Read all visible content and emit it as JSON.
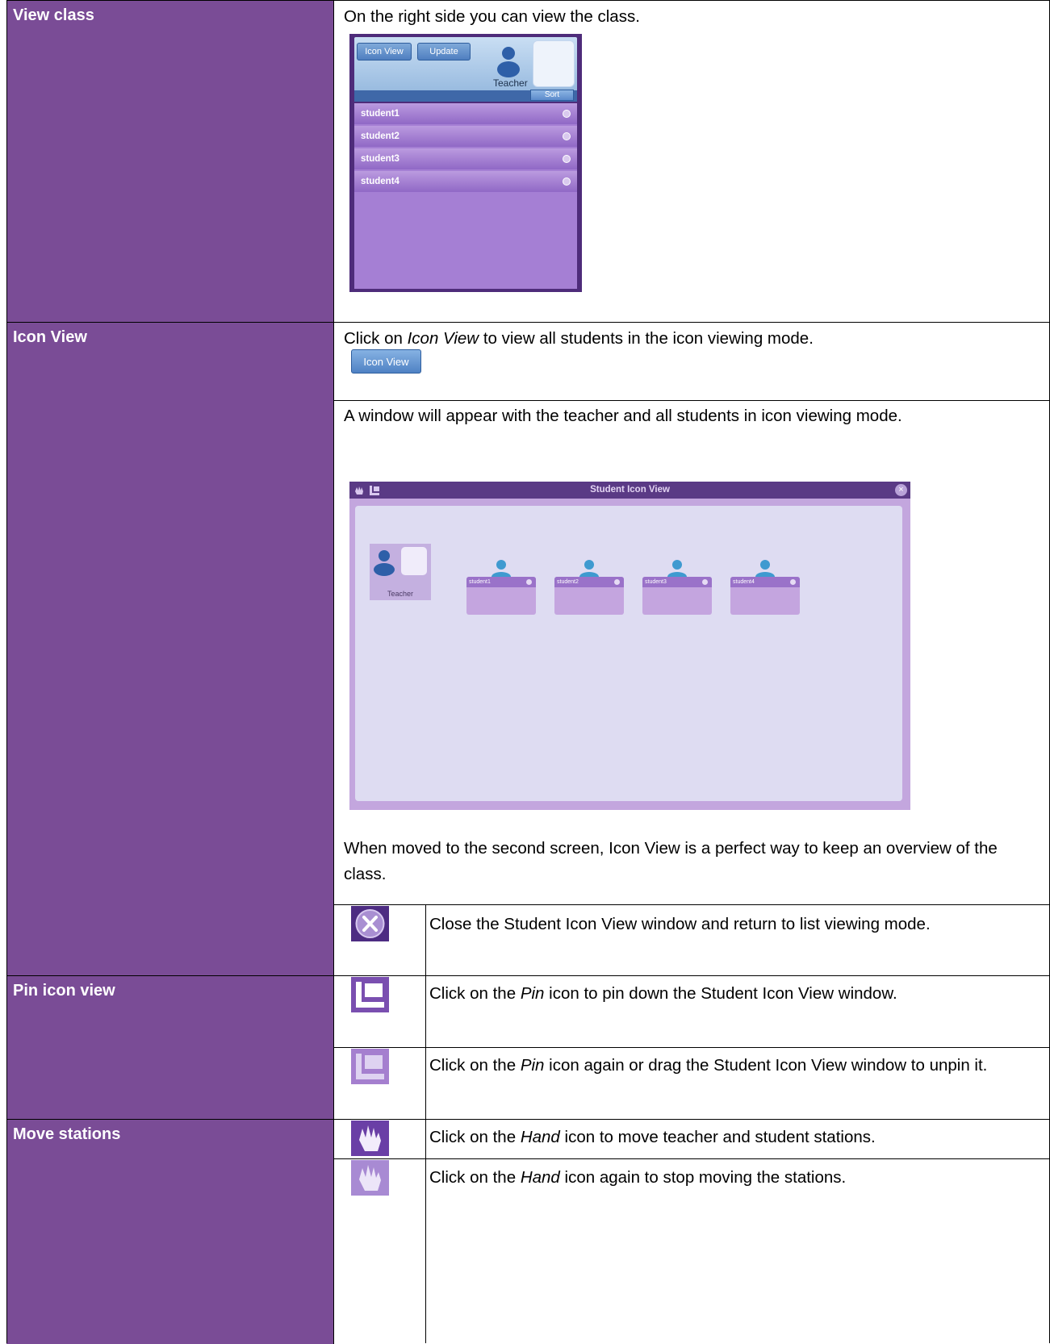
{
  "rows": {
    "view_class": {
      "label": "View class",
      "text": "On the right side you can view the class."
    },
    "icon_view": {
      "label": "Icon View",
      "text_prefix": "Click on ",
      "text_em": "Icon View",
      "text_suffix": " to view all students in the icon viewing mode.",
      "window_text": "A window will appear with the teacher and all students in icon viewing mode.",
      "overview_text": "When moved to the second screen, Icon View is a perfect way to keep an overview of the class.",
      "close_text": "Close the Student Icon View window and return to list viewing mode."
    },
    "pin_icon_view": {
      "label": "Pin icon view",
      "pin_prefix": "Click on the ",
      "pin_em": "Pin",
      "pin_suffix": " icon to pin down the Student Icon View window.",
      "unpin_prefix": "Click on the ",
      "unpin_em": "Pin",
      "unpin_suffix": " icon again or drag the Student Icon View window to unpin it."
    },
    "move_stations": {
      "label": "Move stations",
      "move_prefix": "Click on the ",
      "move_em": "Hand",
      "move_suffix": " icon to move teacher and student stations.",
      "stop_prefix": "Click on the ",
      "stop_em": "Hand",
      "stop_suffix": " icon again to stop moving the stations."
    }
  },
  "class_panel": {
    "icon_view_button": "Icon View",
    "update_button": "Update",
    "teacher_label": "Teacher",
    "sort_button": "Sort",
    "students": [
      "student1",
      "student2",
      "student3",
      "student4"
    ]
  },
  "icon_view_button": "Icon View",
  "icon_window": {
    "title": "Student Icon View",
    "teacher_label": "Teacher",
    "students": [
      "student1",
      "student2",
      "student3",
      "student4"
    ]
  },
  "colors": {
    "label_bg": "#7a4c96",
    "accent_purple": "#5a3a85"
  },
  "icons": {
    "close": "close-icon",
    "pin": "pin-icon",
    "hand": "hand-icon"
  }
}
